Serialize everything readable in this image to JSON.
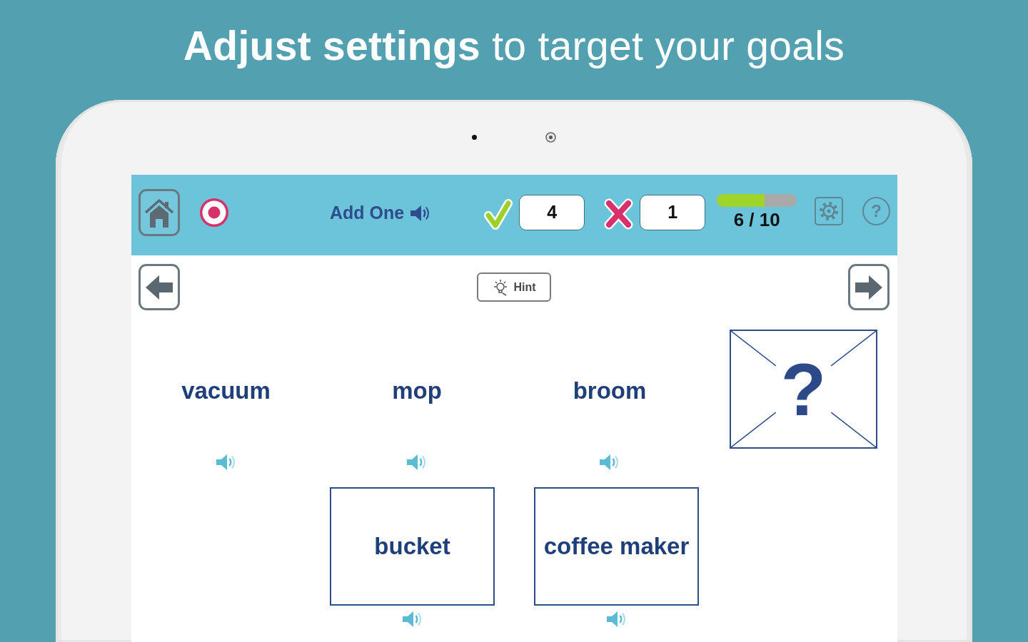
{
  "headline": "**Adjust settings** to target your goals",
  "toolbar": {
    "title": "Add One",
    "correct": "4",
    "incorrect": "1",
    "progress": {
      "level": 0.6,
      "reading": "6 / 10"
    },
    "help": "?"
  },
  "hint": {
    "label": "Hint"
  },
  "choices": [
    {
      "word": "vacuum"
    },
    {
      "word": "mop"
    },
    {
      "word": "broom"
    }
  ],
  "target": {
    "symbol": "?"
  },
  "answers": [
    {
      "word": "bucket"
    },
    {
      "word": "coffee maker"
    }
  ]
}
